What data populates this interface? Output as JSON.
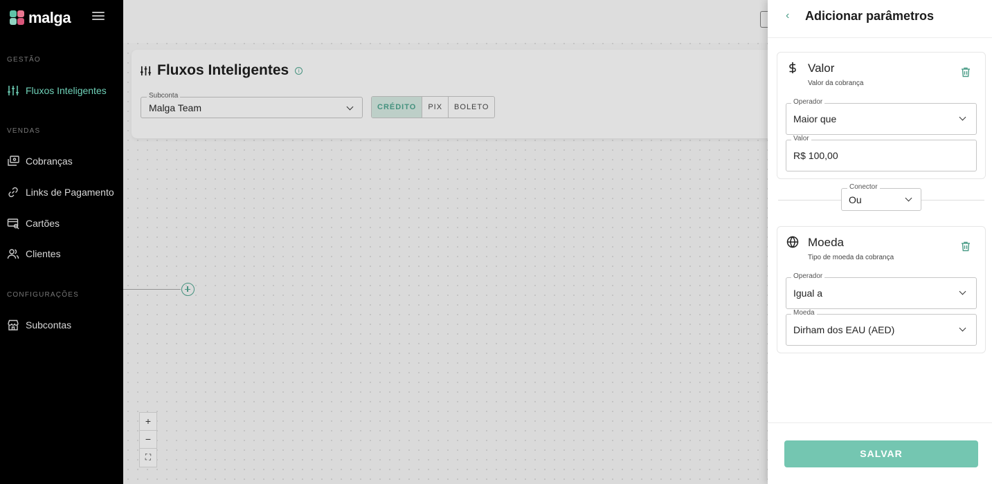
{
  "brand": {
    "name": "malga",
    "accent": "#4a9c87",
    "accent_light": "#74c6b1",
    "logo_colors": [
      "#5fc3a8",
      "#e9768f",
      "#8fd3c1",
      "#d9567a"
    ]
  },
  "sidebar": {
    "sections": [
      {
        "label": "GESTÃO",
        "items": [
          {
            "label": "Fluxos Inteligentes",
            "icon": "sliders-icon",
            "active": true
          }
        ]
      },
      {
        "label": "VENDAS",
        "items": [
          {
            "label": "Cobranças",
            "icon": "charges-icon"
          },
          {
            "label": "Links de Pagamento",
            "icon": "link-icon"
          },
          {
            "label": "Cartões",
            "icon": "cards-icon"
          },
          {
            "label": "Clientes",
            "icon": "users-icon"
          }
        ]
      },
      {
        "label": "CONFIGURAÇÕES",
        "items": [
          {
            "label": "Subcontas",
            "icon": "store-icon"
          }
        ]
      }
    ]
  },
  "main": {
    "title": "Fluxos Inteligentes",
    "subconta": {
      "label": "Subconta",
      "value": "Malga Team"
    },
    "methods": [
      {
        "label": "CRÉDITO",
        "active": true
      },
      {
        "label": "PIX"
      },
      {
        "label": "BOLETO"
      }
    ],
    "zoom": {
      "in": "+",
      "out": "−",
      "fit": "⛶"
    }
  },
  "drawer": {
    "title": "Adicionar parâmetros",
    "params": [
      {
        "title": "Valor",
        "subtitle": "Valor da cobrança",
        "icon": "dollar-icon",
        "fields": [
          {
            "label": "Operador",
            "value": "Maior que",
            "type": "select"
          },
          {
            "label": "Valor",
            "value": "R$ 100,00",
            "type": "input"
          }
        ]
      },
      {
        "title": "Moeda",
        "subtitle": "Tipo de moeda da cobrança",
        "icon": "globe-icon",
        "fields": [
          {
            "label": "Operador",
            "value": "Igual a",
            "type": "select"
          },
          {
            "label": "Moeda",
            "value": "Dirham dos EAU (AED)",
            "type": "select"
          }
        ]
      }
    ],
    "connector": {
      "label": "Conector",
      "value": "Ou"
    },
    "save_label": "SALVAR"
  }
}
